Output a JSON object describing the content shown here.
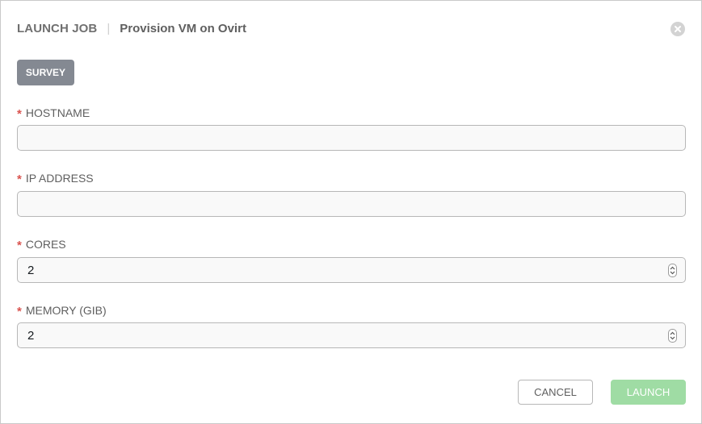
{
  "dialog": {
    "title": "LAUNCH JOB",
    "separator": "|",
    "job_name": "Provision VM on Ovirt"
  },
  "tabs": [
    {
      "label": "SURVEY",
      "active": true
    }
  ],
  "fields": [
    {
      "label": "HOSTNAME",
      "required": true,
      "value": "",
      "type": "text"
    },
    {
      "label": "IP ADDRESS",
      "required": true,
      "value": "",
      "type": "text"
    },
    {
      "label": "CORES",
      "required": true,
      "value": "2",
      "type": "number"
    },
    {
      "label": "MEMORY (GIB)",
      "required": true,
      "value": "2",
      "type": "number"
    }
  ],
  "required_marker": "*",
  "actions": {
    "cancel_label": "CANCEL",
    "launch_label": "LAUNCH"
  },
  "icons": {
    "close": "close-circle-icon",
    "spinner": "number-spinner-icon"
  },
  "colors": {
    "tab_active_bg": "#848992",
    "required": "#d9534f",
    "launch_disabled": "#9fdca4"
  }
}
